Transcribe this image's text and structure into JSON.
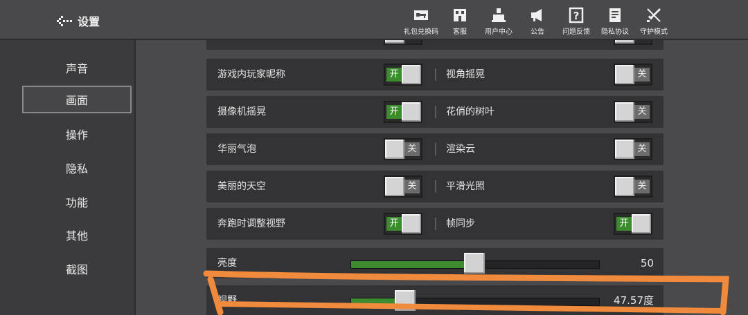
{
  "header": {
    "title": "设置",
    "buttons": [
      {
        "label": "礼包兑换码",
        "icon": "key-icon"
      },
      {
        "label": "客服",
        "icon": "shop-icon"
      },
      {
        "label": "用户中心",
        "icon": "user-icon"
      },
      {
        "label": "公告",
        "icon": "megaphone-icon"
      },
      {
        "label": "问题反馈",
        "icon": "question-icon"
      },
      {
        "label": "隐私协议",
        "icon": "document-icon"
      },
      {
        "label": "守护模式",
        "icon": "sword-icon"
      }
    ]
  },
  "sidebar": {
    "items": [
      {
        "label": "声音"
      },
      {
        "label": "画面",
        "active": true
      },
      {
        "label": "操作"
      },
      {
        "label": "隐私"
      },
      {
        "label": "功能"
      },
      {
        "label": "其他"
      },
      {
        "label": "截图"
      }
    ]
  },
  "toggle_rows": [
    {
      "left": {
        "label": "游戏内玩家昵称",
        "on": true
      },
      "right": {
        "label": "视角摇晃",
        "on": false
      }
    },
    {
      "left": {
        "label": "摄像机摇晃",
        "on": true
      },
      "right": {
        "label": "花俏的树叶",
        "on": false
      }
    },
    {
      "left": {
        "label": "华丽气泡",
        "on": false
      },
      "right": {
        "label": "渲染云",
        "on": false
      }
    },
    {
      "left": {
        "label": "美丽的天空",
        "on": false
      },
      "right": {
        "label": "平滑光照",
        "on": false
      }
    },
    {
      "left": {
        "label": "奔跑时调整视野",
        "on": true
      },
      "right": {
        "label": "帧同步",
        "on": true
      }
    }
  ],
  "toggle_text": {
    "on": "开",
    "off": "关"
  },
  "sliders": {
    "brightness": {
      "label": "亮度",
      "value_text": "50",
      "fraction": 0.5
    },
    "fov": {
      "label": "视野",
      "value_text": "47.57度",
      "fraction": 0.22
    }
  },
  "colors": {
    "accent": "#3d8b2f",
    "annotation": "#f08a3c"
  }
}
